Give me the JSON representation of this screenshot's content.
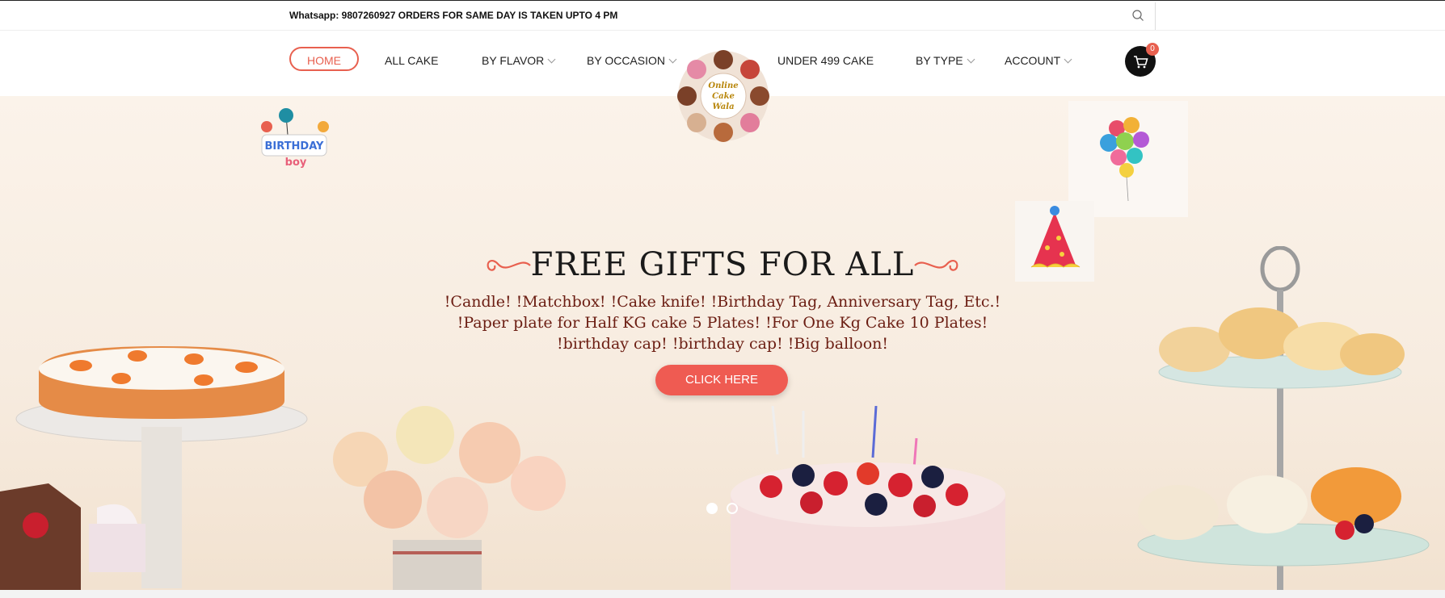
{
  "topbar": {
    "notice": "Whatsapp: 9807260927 ORDERS FOR SAME DAY IS TAKEN UPTO 4 PM",
    "search_icon": "search-icon"
  },
  "nav": {
    "items": [
      {
        "label": "HOME",
        "active": true
      },
      {
        "label": "ALL CAKE"
      },
      {
        "label": "BY FLAVOR",
        "dropdown": true
      },
      {
        "label": "BY OCCASION",
        "dropdown": true
      },
      {
        "label": "UNDER 499 CAKE"
      },
      {
        "label": "BY TYPE",
        "dropdown": true
      },
      {
        "label": "ACCOUNT",
        "dropdown": true
      }
    ],
    "logo_text": [
      "Online",
      "Cake",
      "Wala"
    ],
    "cart_count": "0"
  },
  "hero": {
    "title": "FREE GIFTS FOR ALL",
    "lines": [
      "!Candle! !Matchbox! !Cake knife! !Birthday Tag, Anniversary Tag, Etc.!",
      "!Paper plate for Half KG cake 5 Plates! !For One Kg Cake 10 Plates!",
      "!birthday cap! !birthday cap! !Big balloon!"
    ],
    "cta_label": "CLICK HERE",
    "slides": 2,
    "active_slide": 1,
    "sticker_text": "BIRTHDAY boy"
  },
  "colors": {
    "accent": "#e8604f",
    "cta": "#ef5b52",
    "subtitle": "#6b1d12"
  }
}
